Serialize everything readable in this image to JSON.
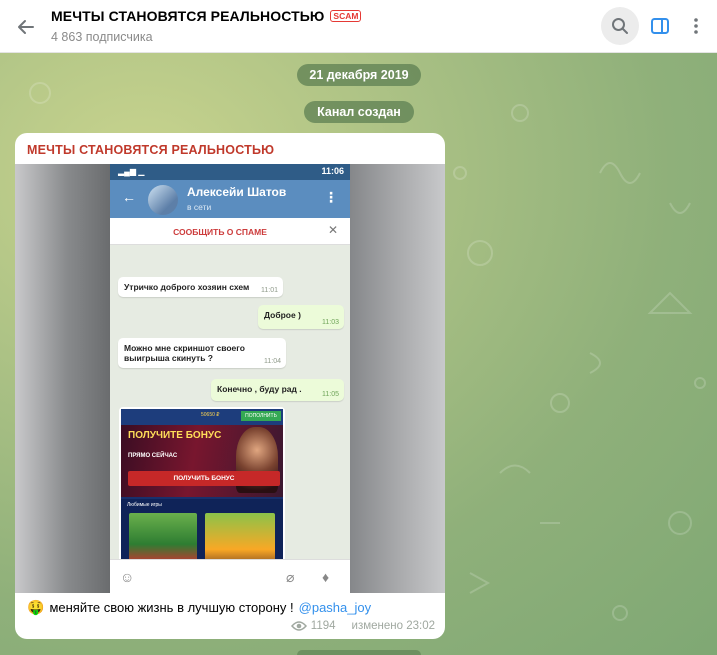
{
  "header": {
    "title": "МЕЧТЫ СТАНОВЯТСЯ РЕАЛЬНОСТЬЮ",
    "scam_badge": "SCAM",
    "subtitle": "4 863 подписчика",
    "icons": [
      "arrow-left-icon",
      "search-icon",
      "sidebar-toggle-icon",
      "more-vertical-icon"
    ]
  },
  "chat": {
    "date_label": "21 декабря 2019",
    "service_label": "Канал создан"
  },
  "message": {
    "author": "МЕЧТЫ СТАНОВЯТСЯ РЕАЛЬНОСТЬЮ",
    "caption_emoji": "🤑",
    "caption_text": "меняйте свою жизнь в лучшую сторону !",
    "mention": "@pasha_joy",
    "views": "1194",
    "edited": "изменено 23:02"
  },
  "screenshot": {
    "status_time": "11:06",
    "contact_name": "Алексейи Шатов",
    "contact_status": "в сети",
    "spam_label": "СООБЩИТЬ О СПАМЕ",
    "bubbles": [
      {
        "text": "Утричко доброго хозяин схем",
        "time": "11:01",
        "dir": "in"
      },
      {
        "text": "Доброе )",
        "time": "11:03",
        "dir": "out"
      },
      {
        "text": "Можно мне скриншот своего выигрыша скинуть ?",
        "time": "11:04",
        "dir": "in"
      },
      {
        "text": "Конечно , буду рад .",
        "time": "11:05",
        "dir": "out"
      }
    ],
    "casino": {
      "balance": "50650 ₽",
      "top_button": "ПОПОЛНИТЬ",
      "headline": "ПОЛУЧИТЕ БОНУС",
      "subline": "ПРЯМО СЕЙЧАС",
      "cta": "ПОЛУЧИТЬ БОНУС",
      "games_label": "Любимые игры"
    }
  },
  "colors": {
    "accent": "#3390ec",
    "scam": "#e53935",
    "author": "#c0392b",
    "service_pill": "#5a7d50"
  }
}
